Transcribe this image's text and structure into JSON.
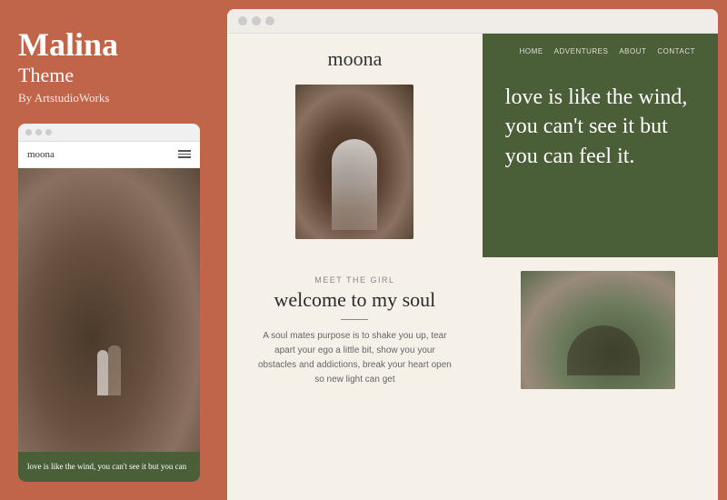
{
  "left_panel": {
    "title_line1": "Malina",
    "title_line2": "Theme",
    "author": "By ArtstudioWorks",
    "mini_logo": "moona",
    "mini_quote": "love is like the wind, you can't see it but you can"
  },
  "browser": {
    "site_logo": "moona",
    "nav": {
      "items": [
        "HOME",
        "ADVENTURES",
        "ABOUT",
        "CONTACT"
      ]
    },
    "hero_quote": "love is like the wind, you can't see it but you can feel it.",
    "meet_label": "MEET THE GIRL",
    "welcome_heading": "welcome to my soul",
    "welcome_text": "A soul mates purpose is to shake you up, tear apart your ego a little bit, show you your obstacles and addictions, break your heart open so new light can get"
  }
}
